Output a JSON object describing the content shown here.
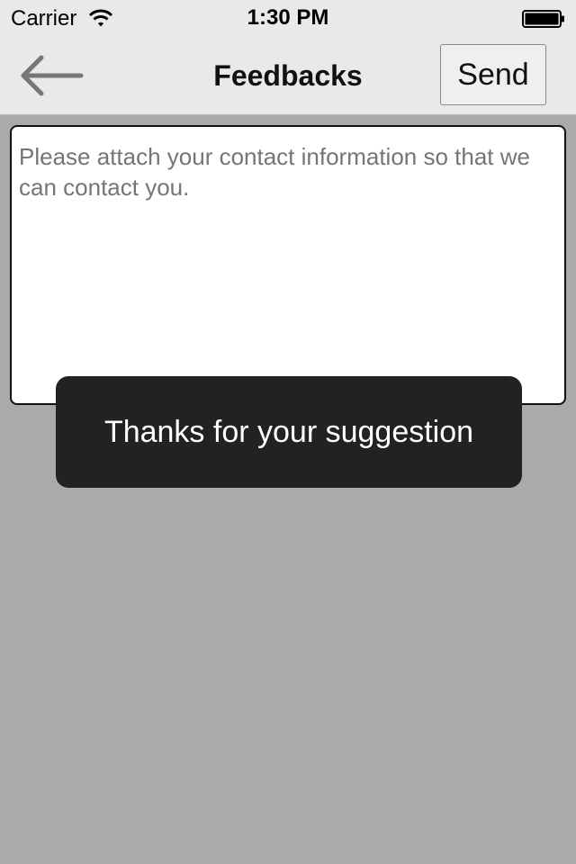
{
  "status_bar": {
    "carrier": "Carrier",
    "time": "1:30 PM",
    "wifi_icon": "wifi-icon",
    "battery_icon": "battery-icon"
  },
  "nav": {
    "back_icon": "arrow-left-icon",
    "title": "Feedbacks",
    "send_label": "Send"
  },
  "feedback": {
    "placeholder": "Please attach your contact information so that we can contact you.",
    "value": ""
  },
  "toast": {
    "message": "Thanks for your suggestion"
  },
  "colors": {
    "background": "#aaaaaa",
    "bar": "#e9e9e9",
    "toast": "#222222"
  }
}
